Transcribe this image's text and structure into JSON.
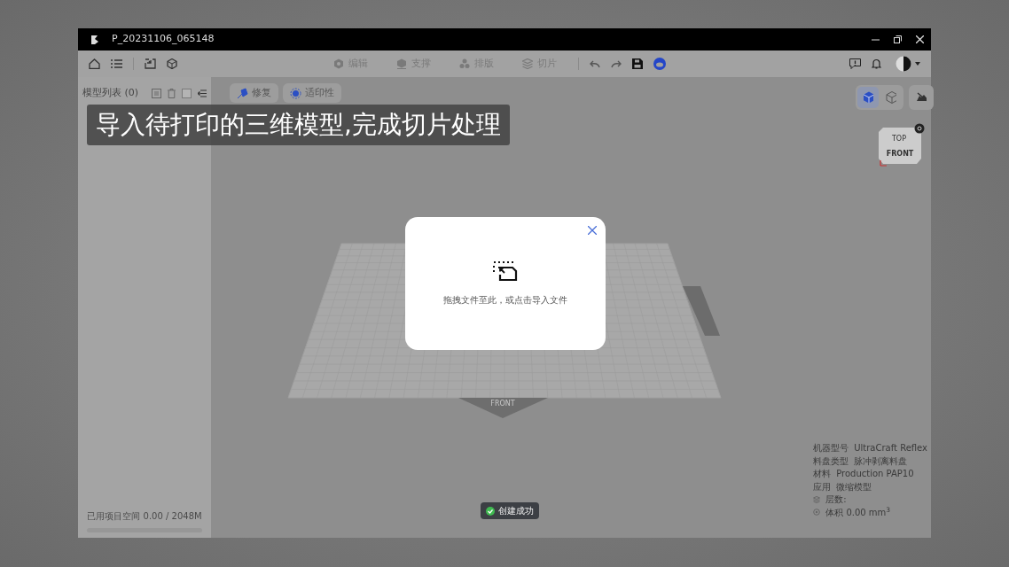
{
  "window": {
    "title": "P_20231106_065148"
  },
  "toolbar": {
    "modes": [
      {
        "label": "编辑",
        "selected": false
      },
      {
        "label": "支撑",
        "selected": false
      },
      {
        "label": "排版",
        "selected": false
      },
      {
        "label": "切片",
        "selected": false
      }
    ]
  },
  "sidebar": {
    "title": "模型列表 (0)",
    "storage": "已用项目空间 0.00 / 2048M"
  },
  "canvas_tools": [
    {
      "label": "修复"
    },
    {
      "label": "适印性"
    }
  ],
  "view_buttons": [
    {
      "kind": "solid",
      "selected": true
    },
    {
      "kind": "wire",
      "selected": false
    }
  ],
  "view_cube": {
    "top": "TOP",
    "front": "FRONT"
  },
  "bed": {
    "front_label": "FRONT"
  },
  "info": [
    {
      "kind": "pair",
      "label": "机器型号",
      "value": "UltraCraft Reflex"
    },
    {
      "kind": "pair",
      "label": "料盘类型",
      "value": "脉冲剥离料盘"
    },
    {
      "kind": "pair",
      "label": "材料",
      "value": "Production PAP10"
    },
    {
      "kind": "pair",
      "label": "应用",
      "value": "微缩模型"
    },
    {
      "kind": "layers",
      "label": "层数:"
    },
    {
      "kind": "volume",
      "label": "体积 0.00 mm$^{3}$"
    }
  ],
  "dialog": {
    "message": "拖拽文件至此，或点击导入文件"
  },
  "toast": {
    "message": "创建成功"
  },
  "caption": "导入待打印的三维模型,完成切片处理"
}
